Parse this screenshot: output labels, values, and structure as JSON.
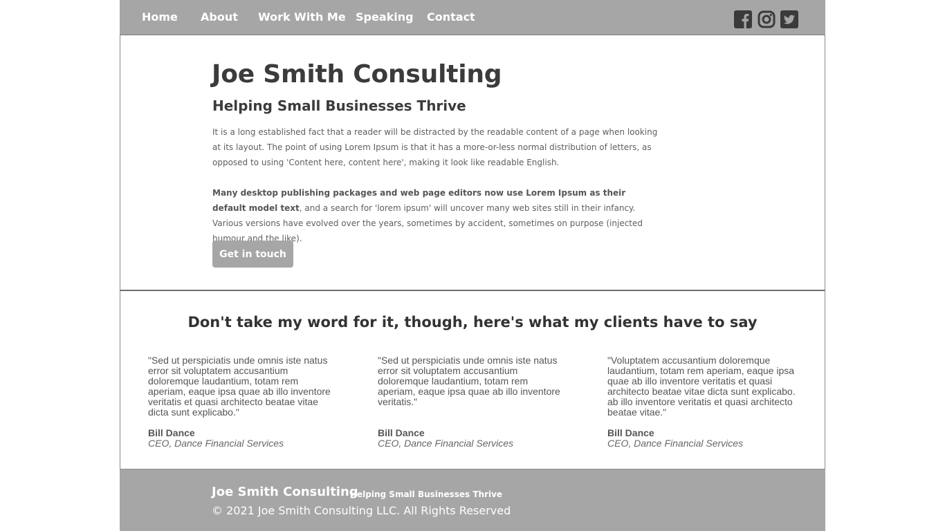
{
  "nav": {
    "items": [
      {
        "label": "Home"
      },
      {
        "label": "About"
      },
      {
        "label": "Work With Me"
      },
      {
        "label": "Speaking"
      },
      {
        "label": "Contact"
      }
    ],
    "social": [
      {
        "icon": "facebook-icon"
      },
      {
        "icon": "instagram-icon"
      },
      {
        "icon": "twitter-icon"
      }
    ]
  },
  "hero": {
    "title": "Joe Smith Consulting",
    "subtitle": "Helping Small Businesses Thrive",
    "paragraph1": "It is a long established fact that a reader will be distracted by the readable content of a page when looking at its layout. The point of using Lorem Ipsum is that it has a more-or-less normal distribution of letters, as opposed to using 'Content here, content here', making it look like readable English.",
    "paragraph2_bold": "Many desktop publishing packages and web page editors now use Lorem Ipsum as their default model text",
    "paragraph2_rest": ", and a search for 'lorem ipsum' will uncover many web sites still in their infancy. Various versions have evolved over the years, sometimes by accident, sometimes on purpose (injected humour and the like).",
    "cta_label": "Get in touch"
  },
  "testimonials": {
    "heading": "Don't take my word for it, though, here's what my clients have to say",
    "items": [
      {
        "quote": "\"Sed ut perspiciatis unde omnis iste natus error sit voluptatem accusantium doloremque laudantium, totam rem aperiam, eaque ipsa quae ab illo inventore veritatis et quasi architecto beatae vitae dicta sunt explicabo.\"",
        "author": "Bill Dance",
        "role": "CEO, Dance Financial Services"
      },
      {
        "quote": "\"Sed ut perspiciatis unde omnis iste natus error sit voluptatem accusantium doloremque laudantium, totam rem aperiam, eaque ipsa quae ab illo inventore veritatis.\"",
        "author": "Bill Dance",
        "role": "CEO, Dance Financial Services"
      },
      {
        "quote": "\"Voluptatem accusantium doloremque laudantium, totam rem aperiam, eaque ipsa quae ab illo inventore veritatis et quasi architecto beatae vitae dicta sunt explicabo. ab illo inventore veritatis et quasi architecto beatae vitae.\"",
        "author": "Bill Dance",
        "role": "CEO, Dance Financial Services"
      }
    ]
  },
  "footer": {
    "title": "Joe Smith Consulting",
    "tagline": "Helping Small Businesses Thrive",
    "copyright": "© 2021 Joe Smith Consulting LLC. All Rights Reserved"
  },
  "colors": {
    "nav_bg": "#a6a6a6",
    "heading_text": "#3b3b3b",
    "body_text": "#5e5e5e"
  }
}
